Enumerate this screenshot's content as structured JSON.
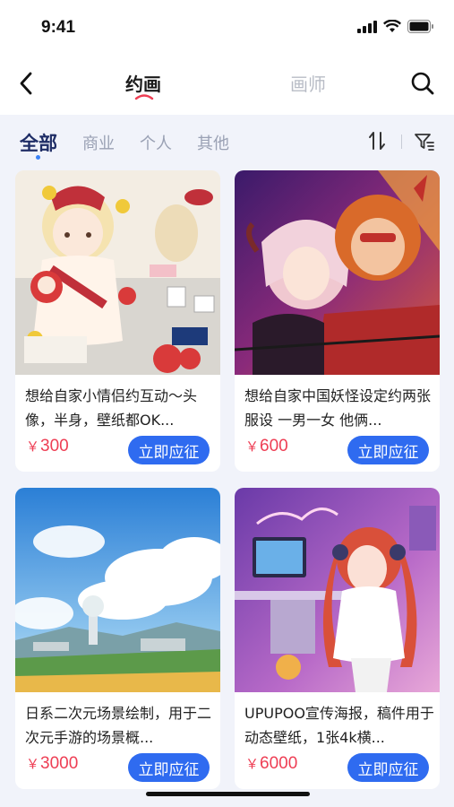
{
  "status": {
    "time": "9:41"
  },
  "nav": {
    "tab_active": "约画",
    "tab_inactive": "画师"
  },
  "categories": [
    "全部",
    "商业",
    "个人",
    "其他"
  ],
  "cards": [
    {
      "title": "想给自家小情侣约互动～头像，半身，壁纸都OK...",
      "currency": "￥",
      "price": "300",
      "button": "立即应征"
    },
    {
      "title": "想给自家中国妖怪设定约两张服设 一男一女 他俩...",
      "currency": "￥",
      "price": "600",
      "button": "立即应征"
    },
    {
      "title": "日系二次元场景绘制，用于二次元手游的场景概...",
      "currency": "￥",
      "price": "3000",
      "button": "立即应征"
    },
    {
      "title": "UPUPOO宣传海报，稿件用于动态壁纸，1张4k横...",
      "currency": "￥",
      "price": "6000",
      "button": "立即应征"
    }
  ],
  "colors": {
    "accent": "#2f6bf0",
    "price": "#ee3e54",
    "background": "#f1f3fa"
  }
}
